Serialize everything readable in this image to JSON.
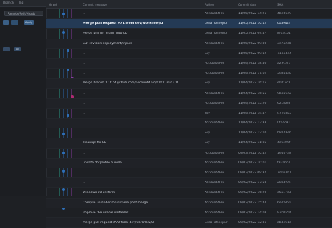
{
  "left_pane": {
    "header_tabs": [
      "Branch",
      "Tag"
    ],
    "branch_filter_value": "Remote/Refs/Heads",
    "buttons": [
      "",
      "",
      "Apply"
    ],
    "tags": [
      "",
      "All"
    ]
  },
  "columns": [
    "Graph",
    "Commit message",
    "Author",
    "Commit date",
    "SHA"
  ],
  "commits": [
    {
      "message": "...",
      "author": "Account4Pro",
      "date": "11/05/2022 14:21",
      "hash": "4b2d6e9"
    },
    {
      "message": "Merge pull request #71 from dev/workflow/CI",
      "author": "Leila Tohnepur",
      "date": "11/05/2022 10:12",
      "hash": "c1a9fb2"
    },
    {
      "message": "Merge branch 'main' into CD",
      "author": "Leila Tohnepur",
      "date": "11/05/2022 09:47",
      "hash": "8f03d51"
    },
    {
      "message": "CD: revision deployment/inputs",
      "author": "Account4Pro",
      "date": "11/05/2022 09:30",
      "hash": "3e7a2c0"
    },
    {
      "message": "...",
      "author": "Sky",
      "date": "11/05/2022 09:12",
      "hash": "71b6de4"
    },
    {
      "message": "...",
      "author": "Account4Pro",
      "date": "11/04/2022 18:40",
      "hash": "a29c5f1"
    },
    {
      "message": "...",
      "author": "Account4Pro",
      "date": "11/04/2022 17:02",
      "hash": "5d814ab"
    },
    {
      "message": "Merge branch 'CD' of github.com/account4pro/CI/CD into CD",
      "author": "Sky",
      "date": "11/04/2022 16:15",
      "hash": "e04f7c3"
    },
    {
      "message": "...",
      "author": "Account4Pro",
      "date": "11/04/2022 15:55",
      "hash": "9b3a6d2"
    },
    {
      "message": "...",
      "author": "Account4Pro",
      "date": "11/04/2022 15:20",
      "hash": "62cf0e8"
    },
    {
      "message": "...",
      "author": "Sky",
      "date": "11/04/2022 14:47",
      "hash": "d7e18b5"
    },
    {
      "message": "...",
      "author": "Account4Pro",
      "date": "11/04/2022 13:33",
      "hash": "0fa4c91"
    },
    {
      "message": "...",
      "author": "Sky",
      "date": "11/04/2022 12:10",
      "hash": "b81d3e6"
    },
    {
      "message": "cleanup: fix CD",
      "author": "Sky",
      "date": "11/04/2022 11:05",
      "hash": "4c6e09f"
    },
    {
      "message": "...",
      "author": "Account4Pro",
      "date": "09/03/2022 10:42",
      "hash": "1e5b7a8"
    },
    {
      "message": "update dotprofile bundle",
      "author": "Account4Pro",
      "date": "09/03/2022 10:01",
      "hash": "f92a6c4"
    },
    {
      "message": "...",
      "author": "Account4Pro",
      "date": "09/03/2022 09:37",
      "hash": "7d0e3b1"
    },
    {
      "message": "...",
      "author": "Account4Pro",
      "date": "09/02/2022 17:58",
      "hash": "28b4f9e"
    },
    {
      "message": "Windows 10 uniform",
      "author": "Account4Pro",
      "date": "09/02/2022 16:20",
      "hash": "c5a17d3"
    },
    {
      "message": "Compile unifinder mainframe post merge",
      "author": "Account4Pro",
      "date": "09/02/2022 15:44",
      "hash": "6e2f8b0"
    },
    {
      "message": "Improve the usable writables",
      "author": "Account4Pro",
      "date": "09/02/2022 14:08",
      "hash": "93c0a5d"
    },
    {
      "message": "Merge pull request #70 from dev/workflow/CI",
      "author": "Leila Tohnepur",
      "date": "09/02/2022 12:31",
      "hash": "ab4e61c"
    }
  ],
  "colors": {
    "selection": "#243a55",
    "lane_blue": "#2e6fb8",
    "lane_teal": "#2aa58f",
    "lane_purple": "#8d3fa8",
    "lane_pink": "#b02a73"
  }
}
